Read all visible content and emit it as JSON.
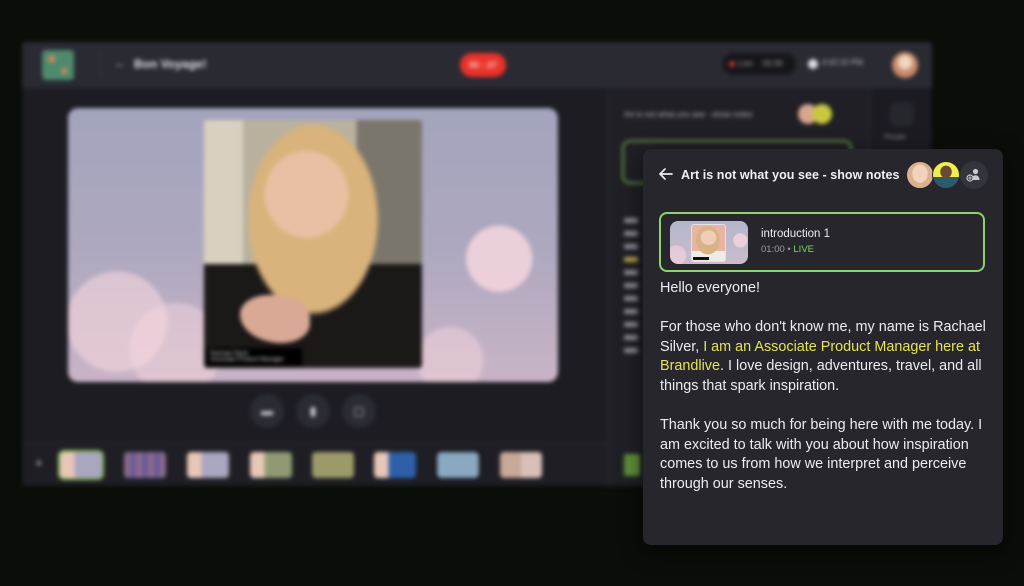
{
  "app": {
    "event_title": "Bon Voyage!",
    "header": {
      "back_glyph": "←",
      "timer_label": "00 : 27",
      "live_label": "Live",
      "live_duration": "00:36",
      "clock_time": "4:42:15 PM"
    },
    "stage": {
      "presenter_name": "Rachael Silver",
      "presenter_subtitle": "Associate Product Manager"
    },
    "controls": [
      {
        "name": "camera",
        "icon": "camera-icon",
        "glyph": "▬"
      },
      {
        "name": "microphone",
        "icon": "microphone-icon",
        "glyph": "▮"
      },
      {
        "name": "screen-share",
        "icon": "screen-share-icon",
        "glyph": "▢"
      }
    ],
    "filmstrip": {
      "collapse_glyph": "▲",
      "thumbnails": [
        {
          "label": "slide 1",
          "active": true
        },
        {
          "label": "slide 2",
          "active": false
        },
        {
          "label": "slide 3",
          "active": false
        },
        {
          "label": "slide 4",
          "active": false
        },
        {
          "label": "slide 5",
          "active": false
        },
        {
          "label": "slide 6",
          "active": false
        },
        {
          "label": "slide 7",
          "active": false
        },
        {
          "label": "slide 8",
          "active": false
        }
      ]
    },
    "side_panel": {
      "title": "Art is not what you see - show notes"
    },
    "rail": {
      "people_label": "People"
    }
  },
  "notes_panel": {
    "back_glyph": "←",
    "title": "Art is not what you see - show notes",
    "avatars": [
      {
        "name": "presenter-avatar-1"
      },
      {
        "name": "presenter-avatar-2"
      }
    ],
    "add_presenter_icon": "add-presenter-icon",
    "segment": {
      "title": "introduction 1",
      "duration": "01:00",
      "separator": " • ",
      "status": "LIVE"
    },
    "notes": {
      "p1": "Hello everyone!",
      "p2_before": "For those who don't know me, my name is Rachael Silver, ",
      "p2_highlight": "I am an Associate Product Manager here at Brandlive",
      "p2_after": ". I love design, adventures, travel, and all things that spark inspiration.",
      "p3": "Thank you so much for being here with me today. I am excited to talk with you about how inspiration comes to us from how we interpret and perceive through our senses."
    }
  },
  "colors": {
    "accent_green": "#8ad36b",
    "highlight_yellow": "#e6e35a",
    "timer_red": "#e8322a",
    "panel_bg": "#26262c",
    "page_bg": "#0a0d08"
  }
}
